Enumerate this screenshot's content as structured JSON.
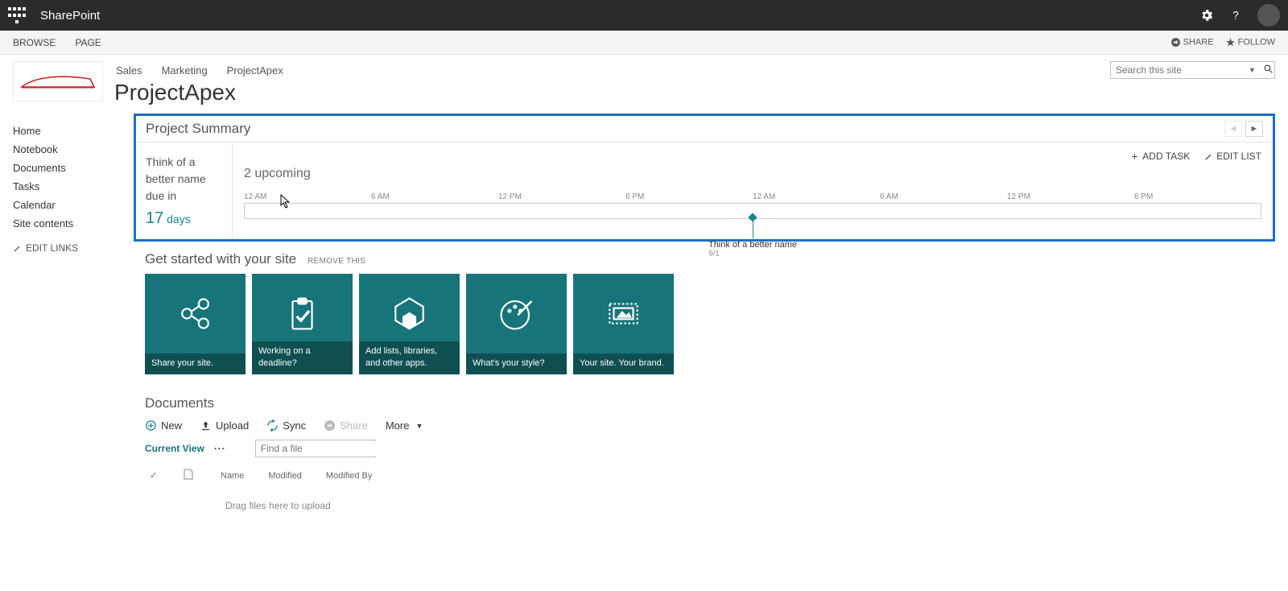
{
  "topbar": {
    "app_name": "SharePoint"
  },
  "ribbon": {
    "tabs": [
      "BROWSE",
      "PAGE"
    ],
    "share": "SHARE",
    "follow": "FOLLOW"
  },
  "header": {
    "breadcrumbs": [
      "Sales",
      "Marketing",
      "ProjectApex"
    ],
    "page_title": "ProjectApex",
    "search_placeholder": "Search this site"
  },
  "leftnav": {
    "items": [
      "Home",
      "Notebook",
      "Documents",
      "Tasks",
      "Calendar",
      "Site contents"
    ],
    "edit_links": "EDIT LINKS"
  },
  "project_summary": {
    "title": "Project Summary",
    "task_name": "Think of a better name due in",
    "days_number": "17",
    "days_label": "days",
    "upcoming": "2 upcoming",
    "add_task": "ADD TASK",
    "edit_list": "EDIT LIST",
    "timeline_labels": [
      "12 AM",
      "6 AM",
      "12 PM",
      "6 PM",
      "12 AM",
      "6 AM",
      "12 PM",
      "6 PM"
    ],
    "marker_label": "Think of a better name",
    "marker_date": "9/1"
  },
  "get_started": {
    "title": "Get started with your site",
    "remove": "REMOVE THIS",
    "tiles": [
      "Share your site.",
      "Working on a deadline?",
      "Add lists, libraries, and other apps.",
      "What's your style?",
      "Your site. Your brand."
    ]
  },
  "documents": {
    "title": "Documents",
    "toolbar": {
      "new": "New",
      "upload": "Upload",
      "sync": "Sync",
      "share": "Share",
      "more": "More"
    },
    "current_view": "Current View",
    "find_file_placeholder": "Find a file",
    "columns": [
      "Name",
      "Modified",
      "Modified By"
    ],
    "dropzone": "Drag files here to upload"
  }
}
